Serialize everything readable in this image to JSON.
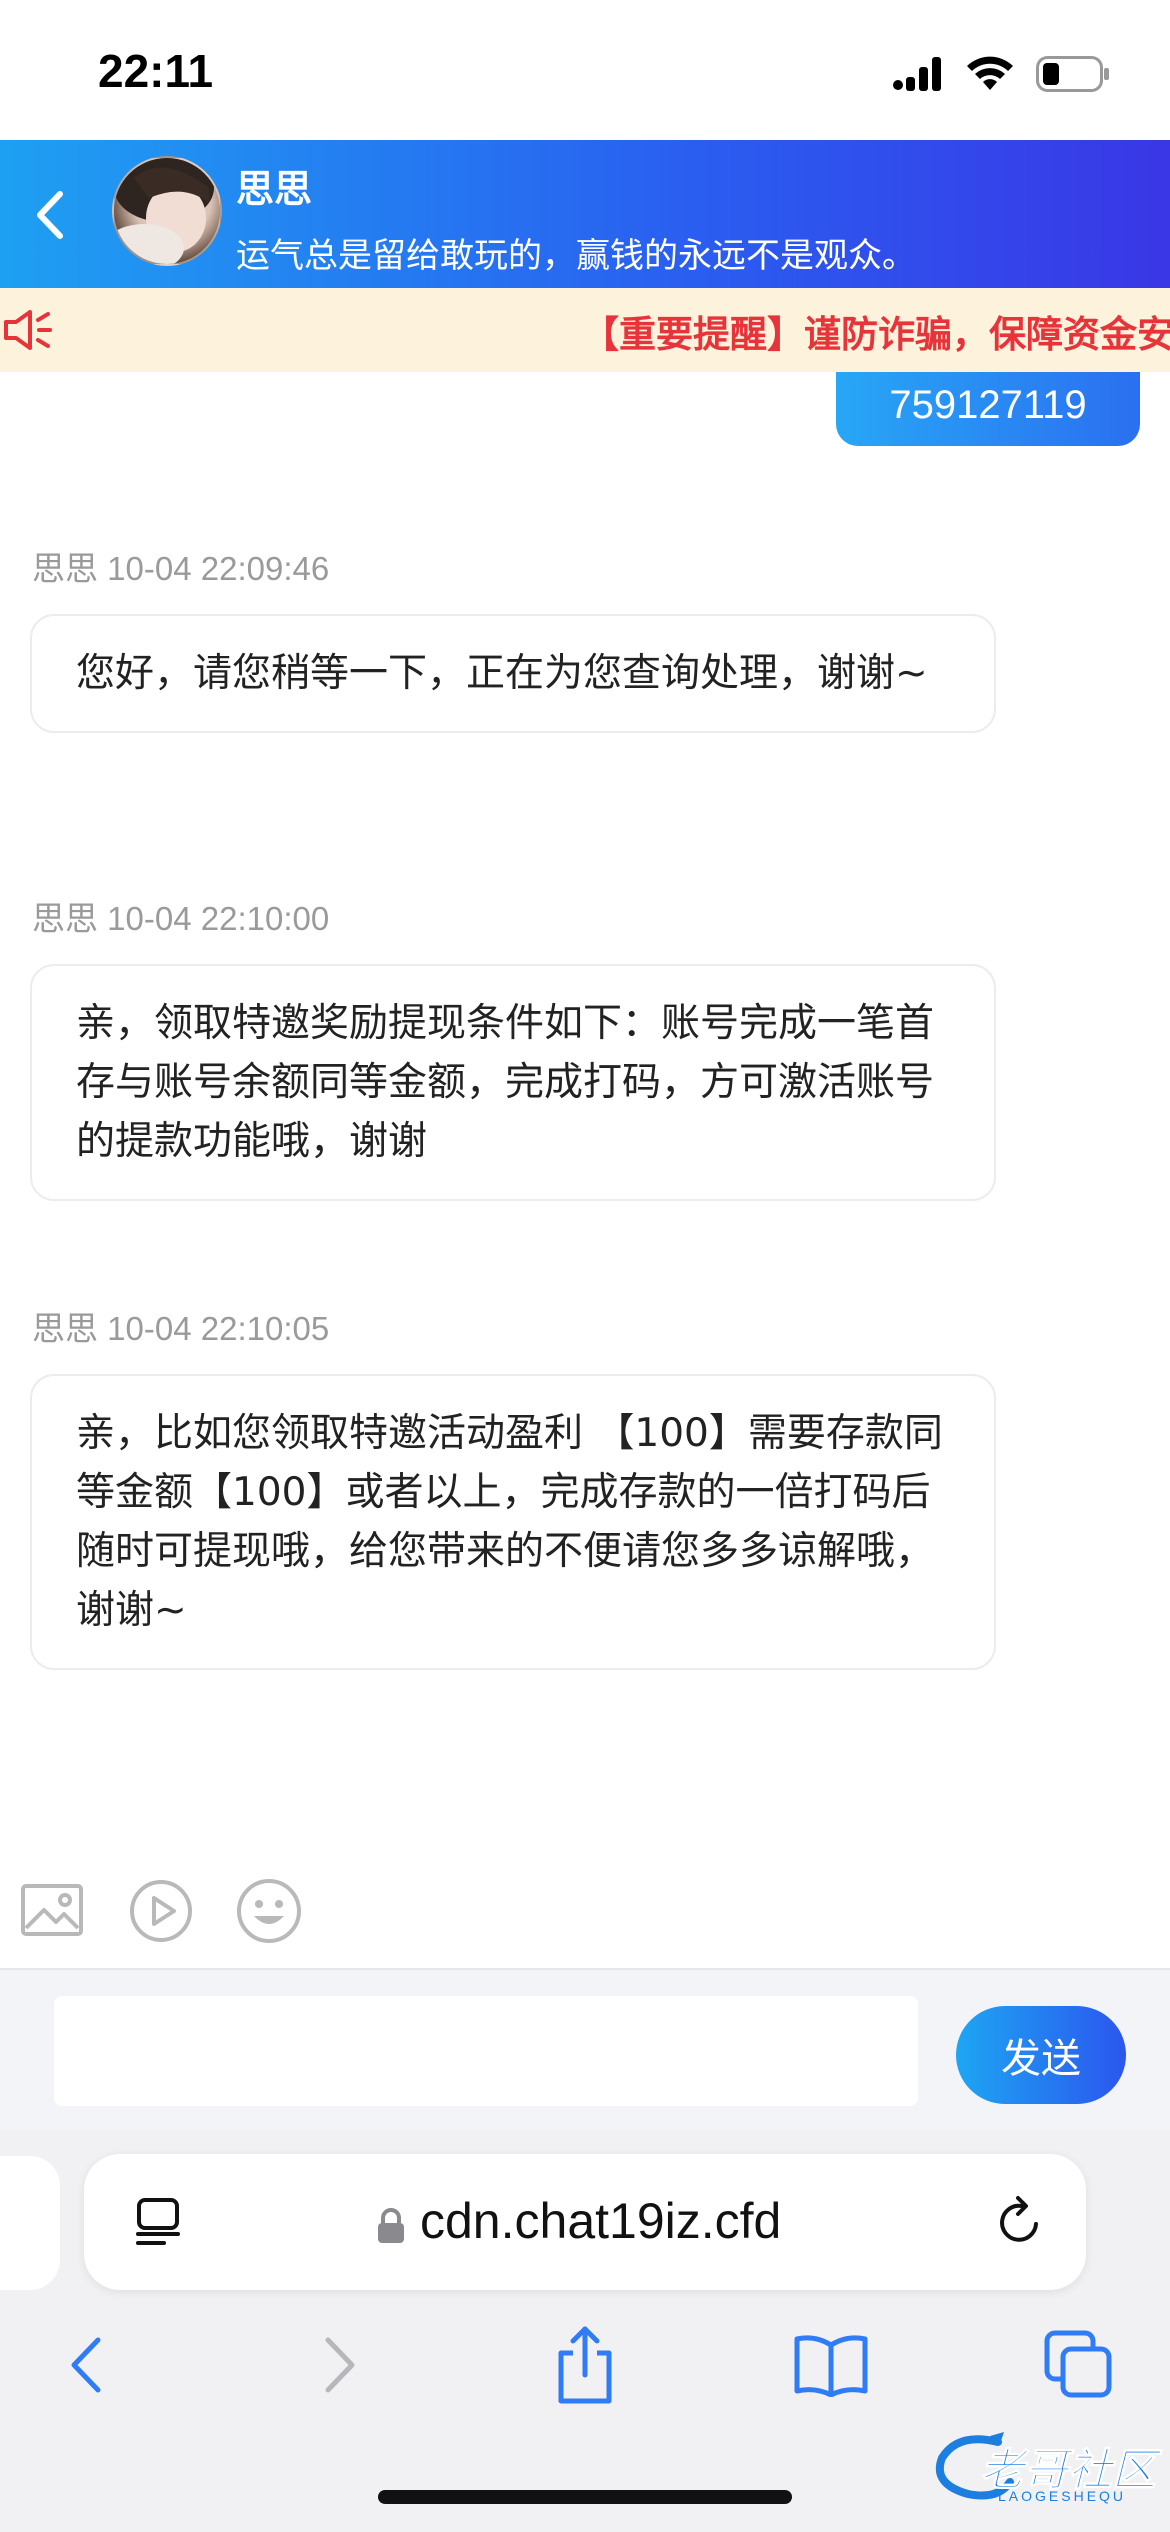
{
  "status_bar": {
    "time": "22:11"
  },
  "header": {
    "agent_name": "思思",
    "motto": "运气总是留给敢玩的，赢钱的永远不是观众。"
  },
  "notice": {
    "text": "【重要提醒】谨防诈骗，保障资金安"
  },
  "user_message": {
    "text": "759127119"
  },
  "messages": [
    {
      "meta": "思思 10-04 22:09:46",
      "text": "您好，请您稍等一下，正在为您查询处理，谢谢~"
    },
    {
      "meta": "思思 10-04 22:10:00",
      "text": "亲，领取特邀奖励提现条件如下：账号完成一笔首存与账号余额同等金额，完成打码，方可激活账号的提款功能哦，谢谢"
    },
    {
      "meta": "思思 10-04 22:10:05",
      "text": "亲，比如您领取特邀活动盈利 【100】需要存款同等金额【100】或者以上，完成存款的一倍打码后随时可提现哦，给您带来的不便请您多多谅解哦，谢谢~"
    }
  ],
  "composer": {
    "placeholder": "",
    "send_label": "发送"
  },
  "browser": {
    "url": "cdn.chat19iz.cfd"
  },
  "watermark": {
    "text": "老哥社区",
    "sub": "LAOGESHEQU"
  },
  "theme": {
    "accent": "#2a6ff0",
    "notice_text": "#e7343a",
    "notice_bg": "#fdf2dc"
  }
}
